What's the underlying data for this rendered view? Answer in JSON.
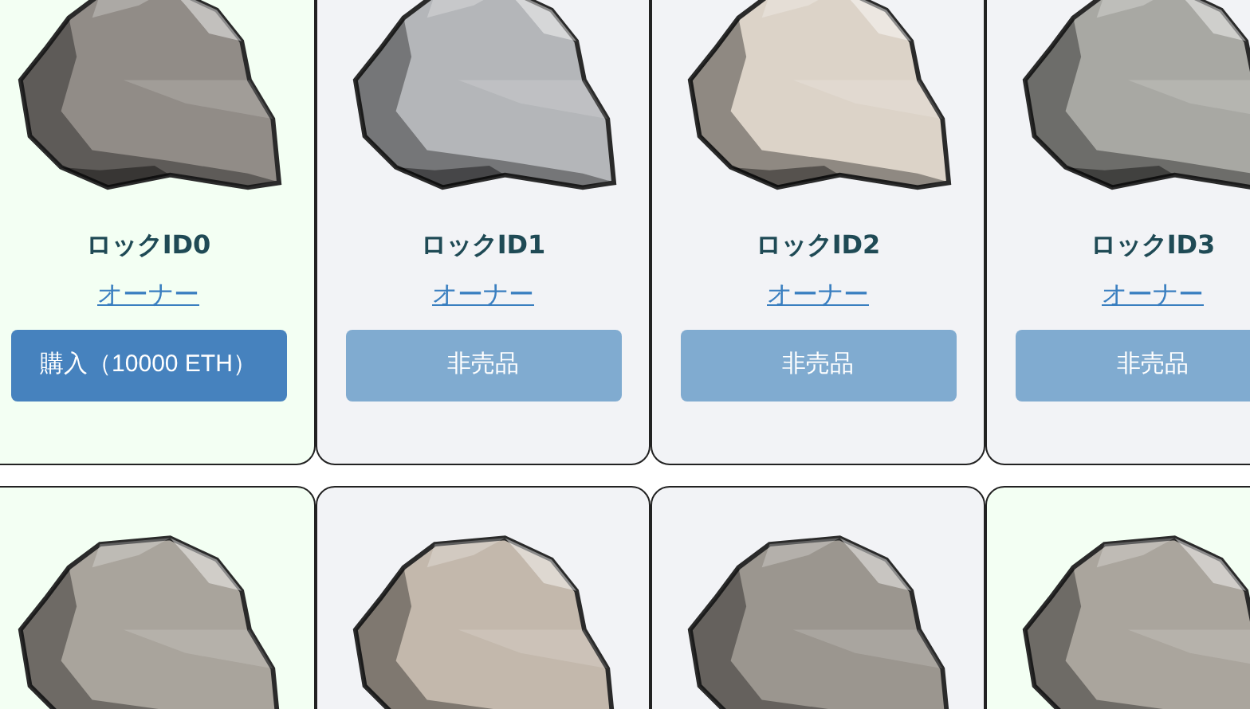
{
  "rocks": [
    {
      "title": "ロックID0",
      "owner_link": "オーナー",
      "button": {
        "label": "購入（10000 ETH）",
        "disabled": false
      },
      "highlighted": true,
      "color": "#918c87"
    },
    {
      "title": "ロックID1",
      "owner_link": "オーナー",
      "button": {
        "label": "非売品",
        "disabled": true
      },
      "highlighted": false,
      "color": "#b4b6b9"
    },
    {
      "title": "ロックID2",
      "owner_link": "オーナー",
      "button": {
        "label": "非売品",
        "disabled": true
      },
      "highlighted": false,
      "color": "#dcd3c8"
    },
    {
      "title": "ロックID3",
      "owner_link": "オーナー",
      "button": {
        "label": "非売品",
        "disabled": true
      },
      "highlighted": false,
      "color": "#a8a8a3"
    },
    {
      "highlighted": true,
      "color": "#a9a49c"
    },
    {
      "highlighted": false,
      "color": "#c3b8ac"
    },
    {
      "highlighted": false,
      "color": "#9b968f"
    },
    {
      "highlighted": true,
      "color": "#aaa59d"
    }
  ]
}
